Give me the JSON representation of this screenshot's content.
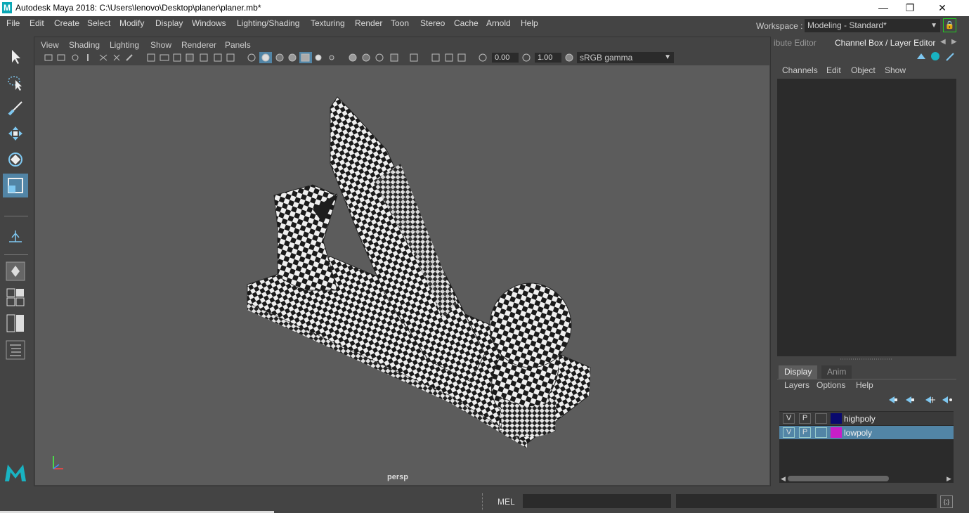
{
  "window": {
    "title": "Autodesk Maya 2018: C:\\Users\\lenovo\\Desktop\\planer\\planer.mb*",
    "logo_letter": "M",
    "minimize": "—",
    "restore": "❐",
    "close": "✕"
  },
  "menubar": [
    "File",
    "Edit",
    "Create",
    "Select",
    "Modify",
    "Display",
    "Windows",
    "Lighting/Shading",
    "Texturing",
    "Render",
    "Toon",
    "Stereo",
    "Cache",
    "Arnold",
    "Help"
  ],
  "workspace": {
    "label": "Workspace :",
    "value": "Modeling - Standard*"
  },
  "viewport": {
    "menu": [
      "View",
      "Shading",
      "Lighting",
      "Show",
      "Renderer",
      "Panels"
    ],
    "exposure": "0.00",
    "gamma": "1.00",
    "color_space": "sRGB gamma",
    "camera_label": "persp"
  },
  "right_panel": {
    "tabs": [
      "ibute Editor",
      "Channel Box / Layer Editor"
    ],
    "channel_menu": [
      "Channels",
      "Edit",
      "Object",
      "Show"
    ],
    "layer_tabs": [
      "Display",
      "Anim"
    ],
    "layer_menu": [
      "Layers",
      "Options",
      "Help"
    ],
    "layers": [
      {
        "v": "V",
        "p": "P",
        "name": "highpoly",
        "color": "#0a0a6e",
        "selected": false
      },
      {
        "v": "V",
        "p": "P",
        "name": "lowpoly",
        "color": "#c81ec8",
        "selected": true
      }
    ]
  },
  "command_line": {
    "language": "MEL",
    "value": ""
  },
  "colors": {
    "accent": "#5285a6",
    "viewport_bg": "#5c5c5c",
    "panel": "#444444",
    "field": "#2b2b2b"
  }
}
